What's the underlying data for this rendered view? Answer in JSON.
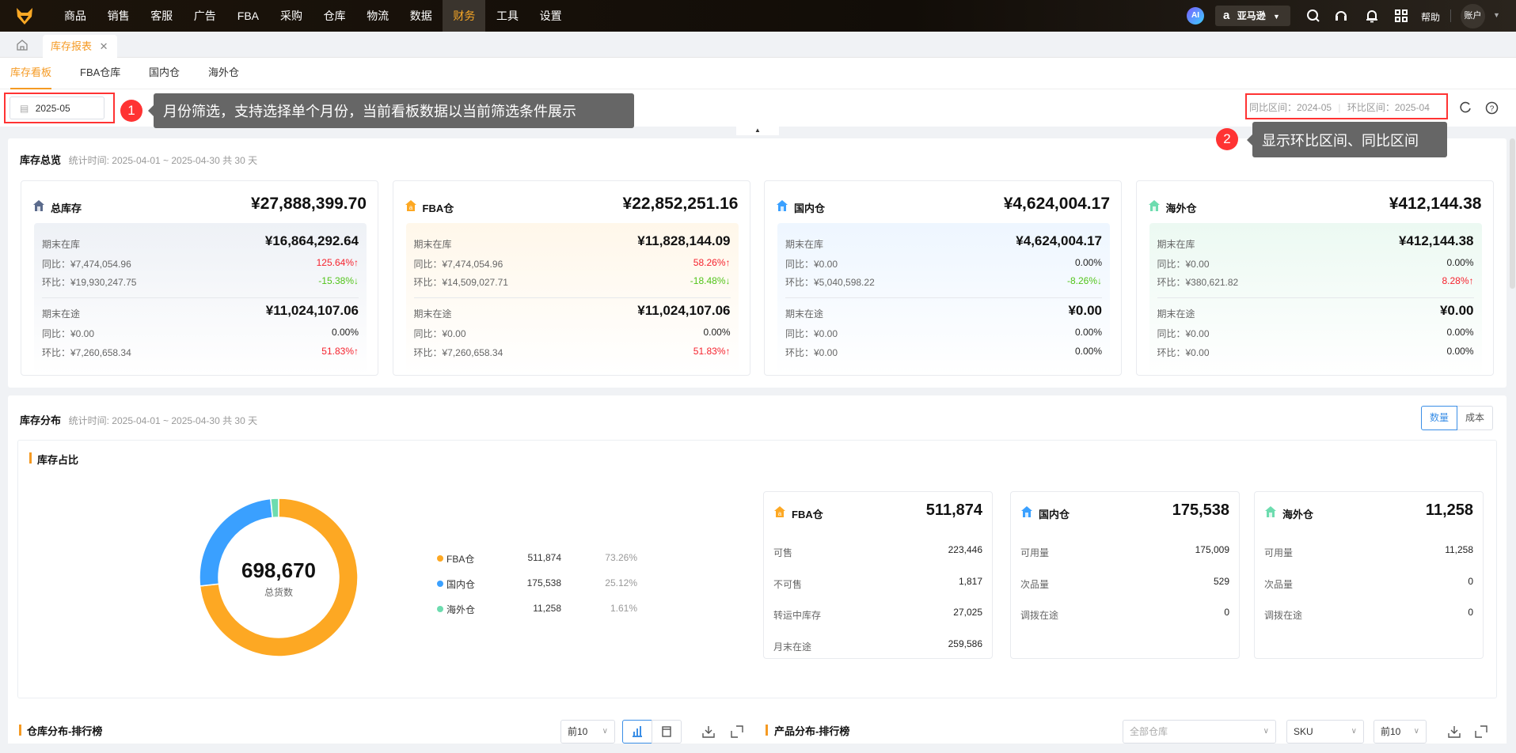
{
  "nav": {
    "items": [
      "商品",
      "销售",
      "客服",
      "广告",
      "FBA",
      "采购",
      "仓库",
      "物流",
      "数据",
      "财务",
      "工具",
      "设置"
    ],
    "active": "财务",
    "ai": "AI",
    "store": "亚马逊",
    "help": "帮助",
    "account": "账户"
  },
  "tabs": {
    "active": "库存报表"
  },
  "subtabs": [
    "库存看板",
    "FBA仓库",
    "国内仓",
    "海外仓"
  ],
  "filter": {
    "month": "2025-05",
    "yoy_label": "同比区间：2024-05",
    "mom_label": "环比区间：2025-04"
  },
  "annotations": [
    {
      "num": "1",
      "text": "月份筛选，支持选择单个月份，当前看板数据以当前筛选条件展示"
    },
    {
      "num": "2",
      "text": "显示环比区间、同比区间"
    }
  ],
  "overview": {
    "title": "库存总览",
    "period": "统计时间: 2025-04-01 ~ 2025-04-30 共 30 天",
    "cards": [
      {
        "name": "总库存",
        "total": "¥27,888,399.70",
        "stock_label": "期末在库",
        "stock": "¥16,864,292.64",
        "s_yoy": "同比：¥7,474,054.96",
        "s_yoy_pct": "125.64%↑",
        "s_yoy_dir": "up",
        "s_mom": "环比：¥19,930,247.75",
        "s_mom_pct": "-15.38%↓",
        "s_mom_dir": "down",
        "transit_label": "期末在途",
        "transit": "¥11,024,107.06",
        "t_yoy": "同比：¥0.00",
        "t_yoy_pct": "0.00%",
        "t_yoy_dir": "zero",
        "t_mom": "环比：¥7,260,658.34",
        "t_mom_pct": "51.83%↑",
        "t_mom_dir": "up",
        "color": "#5b6b8c",
        "bg": "#eef1f6"
      },
      {
        "name": "FBA仓",
        "total": "¥22,852,251.16",
        "stock_label": "期末在库",
        "stock": "¥11,828,144.09",
        "s_yoy": "同比：¥7,474,054.96",
        "s_yoy_pct": "58.26%↑",
        "s_yoy_dir": "up",
        "s_mom": "环比：¥14,509,027.71",
        "s_mom_pct": "-18.48%↓",
        "s_mom_dir": "down",
        "transit_label": "期末在途",
        "transit": "¥11,024,107.06",
        "t_yoy": "同比：¥0.00",
        "t_yoy_pct": "0.00%",
        "t_yoy_dir": "zero",
        "t_mom": "环比：¥7,260,658.34",
        "t_mom_pct": "51.83%↑",
        "t_mom_dir": "up",
        "color": "#fda823",
        "bg": "#fff7ea"
      },
      {
        "name": "国内仓",
        "total": "¥4,624,004.17",
        "stock_label": "期末在库",
        "stock": "¥4,624,004.17",
        "s_yoy": "同比：¥0.00",
        "s_yoy_pct": "0.00%",
        "s_yoy_dir": "zero",
        "s_mom": "环比：¥5,040,598.22",
        "s_mom_pct": "-8.26%↓",
        "s_mom_dir": "down",
        "transit_label": "期末在途",
        "transit": "¥0.00",
        "t_yoy": "同比：¥0.00",
        "t_yoy_pct": "0.00%",
        "t_yoy_dir": "zero",
        "t_mom": "环比：¥0.00",
        "t_mom_pct": "0.00%",
        "t_mom_dir": "zero",
        "color": "#3aa0ff",
        "bg": "#eef6ff"
      },
      {
        "name": "海外仓",
        "total": "¥412,144.38",
        "stock_label": "期末在库",
        "stock": "¥412,144.38",
        "s_yoy": "同比：¥0.00",
        "s_yoy_pct": "0.00%",
        "s_yoy_dir": "zero",
        "s_mom": "环比：¥380,621.82",
        "s_mom_pct": "8.28%↑",
        "s_mom_dir": "up",
        "transit_label": "期末在途",
        "transit": "¥0.00",
        "t_yoy": "同比：¥0.00",
        "t_yoy_pct": "0.00%",
        "t_yoy_dir": "zero",
        "t_mom": "环比：¥0.00",
        "t_mom_pct": "0.00%",
        "t_mom_dir": "zero",
        "color": "#6ddcaf",
        "bg": "#ecf9f2"
      }
    ]
  },
  "distribution": {
    "title": "库存分布",
    "period": "统计时间: 2025-04-01 ~ 2025-04-30 共 30 天",
    "toggle": [
      "数量",
      "成本"
    ],
    "toggle_active": "数量",
    "share_title": "库存占比",
    "total": "698,670",
    "total_label": "总货数",
    "legend": [
      {
        "name": "FBA仓",
        "value": "511,874",
        "pct": "73.26%",
        "fraction": 0.7326,
        "color": "#fda823"
      },
      {
        "name": "国内仓",
        "value": "175,538",
        "pct": "25.12%",
        "fraction": 0.2512,
        "color": "#3aa0ff"
      },
      {
        "name": "海外仓",
        "value": "11,258",
        "pct": "1.61%",
        "fraction": 0.0161,
        "color": "#6ddcaf"
      }
    ],
    "cards": [
      {
        "name": "FBA仓",
        "total": "511,874",
        "color": "#fda823",
        "rows": [
          [
            "可售",
            "223,446"
          ],
          [
            "不可售",
            "1,817"
          ],
          [
            "转运中库存",
            "27,025"
          ],
          [
            "月末在途",
            "259,586"
          ]
        ]
      },
      {
        "name": "国内仓",
        "total": "175,538",
        "color": "#3aa0ff",
        "rows": [
          [
            "可用量",
            "175,009"
          ],
          [
            "次品量",
            "529"
          ],
          [
            "调拨在途",
            "0"
          ]
        ]
      },
      {
        "name": "海外仓",
        "total": "11,258",
        "color": "#6ddcaf",
        "rows": [
          [
            "可用量",
            "11,258"
          ],
          [
            "次品量",
            "0"
          ],
          [
            "调拨在途",
            "0"
          ]
        ]
      }
    ]
  },
  "rank": {
    "warehouse_title": "仓库分布-排行榜",
    "warehouse_top": "前10",
    "product_title": "产品分布-排行榜",
    "product_wh_placeholder": "全部仓库",
    "product_dim": "SKU",
    "product_top": "前10"
  }
}
